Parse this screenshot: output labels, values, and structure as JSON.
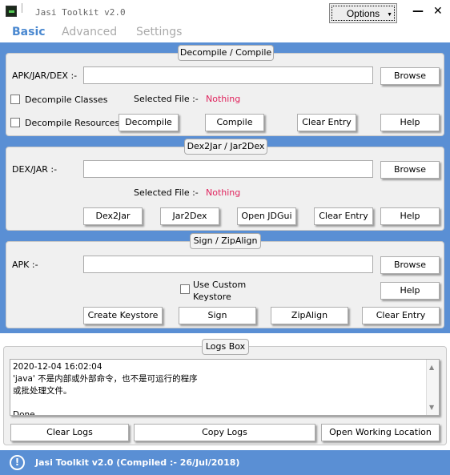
{
  "window": {
    "title": "Jasi Toolkit v2.0",
    "options_label": "Options",
    "minimize": "—",
    "close": "✕"
  },
  "tabs": [
    {
      "label": "Basic"
    },
    {
      "label": "Advanced"
    },
    {
      "label": "Settings"
    }
  ],
  "decompile": {
    "title": "Decompile / Compile",
    "input_label": "APK/JAR/DEX :-",
    "input_value": "",
    "browse": "Browse",
    "decompile_classes": "Decompile Classes",
    "decompile_resources": "Decompile Resources",
    "selected_label": "Selected File :-",
    "selected_value": "Nothing",
    "decompile_btn": "Decompile",
    "compile_btn": "Compile",
    "clear_btn": "Clear Entry",
    "help_btn": "Help"
  },
  "dex": {
    "title": "Dex2Jar / Jar2Dex",
    "input_label": "DEX/JAR :-",
    "input_value": "",
    "browse": "Browse",
    "selected_label": "Selected File :-",
    "selected_value": "Nothing",
    "dex2jar": "Dex2Jar",
    "jar2dex": "Jar2Dex",
    "jdgui": "Open JDGui",
    "clear_btn": "Clear Entry",
    "help_btn": "Help"
  },
  "sign": {
    "title": "Sign / ZipAlign",
    "input_label": "APK :-",
    "input_value": "",
    "browse": "Browse",
    "custom_keystore": "Use Custom\nKeystore",
    "help_btn": "Help",
    "create_keystore": "Create Keystore",
    "sign_btn": "Sign",
    "zipalign": "ZipAlign",
    "clear_btn": "Clear Entry"
  },
  "logs": {
    "title": "Logs Box",
    "content": "2020-12-04 16:02:04\n'java' 不是内部或外部命令，也不是可运行的程序\n或批处理文件。\n\nDone...",
    "clear": "Clear Logs",
    "copy": "Copy Logs",
    "open": "Open Working Location"
  },
  "footer": {
    "text": "Jasi Toolkit v2.0 (Compiled :- 26/Jul/2018)",
    "icon": "info-icon"
  }
}
